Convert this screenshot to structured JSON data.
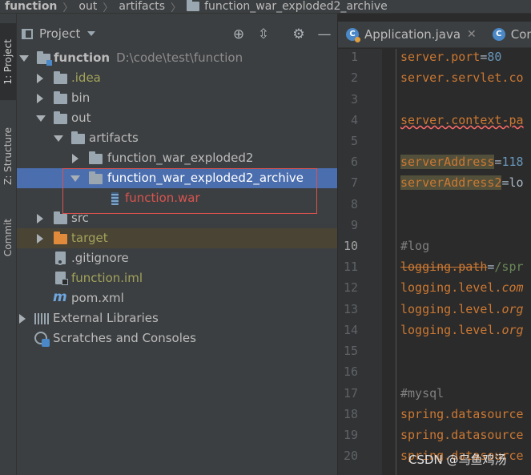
{
  "breadcrumb": {
    "items": [
      "function",
      "out",
      "artifacts",
      "function_war_exploded2_archive"
    ]
  },
  "left_stripe": {
    "items": [
      {
        "label": "1: Project",
        "active": true
      },
      {
        "label": "Z: Structure",
        "active": false
      },
      {
        "label": "Commit",
        "active": false
      }
    ]
  },
  "project_panel": {
    "title": "Project",
    "tools": [
      "target-icon",
      "collapse-icon",
      "gear-icon",
      "minimize-icon"
    ],
    "tree": [
      {
        "label": "function",
        "path": "D:\\code\\test\\function",
        "color": "#bbbbbb"
      },
      {
        "label": ".idea",
        "color": "#a2a35a"
      },
      {
        "label": "bin",
        "color": "#bbbbbb"
      },
      {
        "label": "out",
        "color": "#bbbbbb"
      },
      {
        "label": "artifacts",
        "color": "#bbbbbb"
      },
      {
        "label": "function_war_exploded2",
        "color": "#bbbbbb"
      },
      {
        "label": "function_war_exploded2_archive",
        "color": "#ffffff"
      },
      {
        "label": "function.war",
        "color": "#d9534f"
      },
      {
        "label": "src",
        "color": "#bbbbbb"
      },
      {
        "label": "target",
        "color": "#a2a35a"
      },
      {
        "label": ".gitignore",
        "color": "#bbbbbb"
      },
      {
        "label": "function.iml",
        "color": "#a2a35a"
      },
      {
        "label": "pom.xml",
        "color": "#bbbbbb"
      },
      {
        "label": "External Libraries",
        "color": "#bbbbbb"
      },
      {
        "label": "Scratches and Consoles",
        "color": "#bbbbbb"
      }
    ]
  },
  "editor": {
    "tabs": [
      {
        "label": "Application.java",
        "icon": "C",
        "active": false
      },
      {
        "label": "Con",
        "icon": "C",
        "active": false
      }
    ],
    "lines": [
      {
        "n": "1",
        "key": "server.port",
        "eq": "=",
        "val": "80"
      },
      {
        "n": "2",
        "key": "server.servlet.co"
      },
      {
        "n": "3"
      },
      {
        "n": "4",
        "key": "server.context-pa"
      },
      {
        "n": "5"
      },
      {
        "n": "6",
        "key": "serverAddress",
        "eq": "=",
        "val": "118"
      },
      {
        "n": "7",
        "key": "serverAddress2",
        "eq": "=",
        "val": "lo"
      },
      {
        "n": "8"
      },
      {
        "n": "9"
      },
      {
        "n": "10",
        "comment": "#log"
      },
      {
        "n": "11",
        "key": "logging.path",
        "eq": "=",
        "val": "/spr"
      },
      {
        "n": "12",
        "key": "logging.level.",
        "keyi": "com"
      },
      {
        "n": "13",
        "key": "logging.level.",
        "keyi": "org"
      },
      {
        "n": "14",
        "key": "logging.level.",
        "keyi": "org"
      },
      {
        "n": "15"
      },
      {
        "n": "16"
      },
      {
        "n": "17",
        "comment": "#mysql"
      },
      {
        "n": "18",
        "key": "spring.datasource"
      },
      {
        "n": "19",
        "key": "spring.datasource"
      },
      {
        "n": "20",
        "key": "spring.datasource"
      }
    ]
  },
  "watermark": "CSDN @乌鱼鸡汤"
}
